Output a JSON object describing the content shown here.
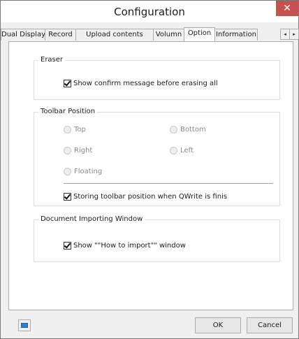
{
  "window": {
    "title": "Configuration",
    "close_glyph": "✕"
  },
  "tabs": [
    {
      "label": "Dual Display"
    },
    {
      "label": "Record"
    },
    {
      "label": "Upload contents"
    },
    {
      "label": "Volumn"
    },
    {
      "label": "Option",
      "active": true
    },
    {
      "label": "Information"
    }
  ],
  "tab_scroll": {
    "left_glyph": "◂",
    "right_glyph": "▸"
  },
  "eraser": {
    "title": "Eraser",
    "confirm_label": "Show confirm message before erasing all",
    "confirm_checked": true
  },
  "toolbar_position": {
    "title": "Toolbar Position",
    "options": [
      "Top",
      "Bottom",
      "Right",
      "Left",
      "Floating"
    ],
    "enabled": false,
    "store_label": "Storing toolbar position when QWrite is finis",
    "store_checked": true
  },
  "document_importing": {
    "title": "Document Importing Window",
    "show_label": "Show \"\"How to import\"\" window",
    "show_checked": true
  },
  "footer": {
    "ok_label": "OK",
    "cancel_label": "Cancel",
    "icon": "keyboard-icon",
    "accent_color": "#2f7fd0"
  }
}
